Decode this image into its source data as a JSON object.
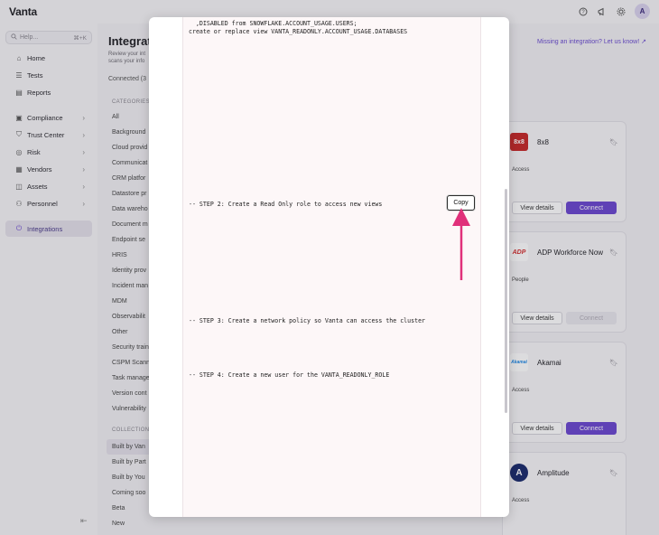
{
  "app": {
    "brand": "Vanta",
    "user_initial": "A"
  },
  "top_icons": [
    "help-icon",
    "megaphone-icon",
    "gear-icon"
  ],
  "sidebar": {
    "search_placeholder": "Help...",
    "search_shortcut": "⌘+K",
    "items": [
      {
        "label": "Home",
        "icon": "home-icon"
      },
      {
        "label": "Tests",
        "icon": "list-icon"
      },
      {
        "label": "Reports",
        "icon": "report-icon"
      },
      {
        "label": "Compliance",
        "icon": "checklist-icon",
        "chevron": true
      },
      {
        "label": "Trust Center",
        "icon": "shield-icon",
        "chevron": true
      },
      {
        "label": "Risk",
        "icon": "risk-icon",
        "chevron": true
      },
      {
        "label": "Vendors",
        "icon": "vendor-icon",
        "chevron": true
      },
      {
        "label": "Assets",
        "icon": "assets-icon",
        "chevron": true
      },
      {
        "label": "Personnel",
        "icon": "people-icon",
        "chevron": true
      },
      {
        "label": "Integrations",
        "icon": "plug-icon",
        "active": true
      }
    ]
  },
  "main": {
    "title": "Integrat",
    "subtitle_1": "Review your int",
    "subtitle_2": "scans your info",
    "connected": "Connected (3",
    "missing_link": "Missing an integration? Let us know!",
    "categories_head": "CATEGORIES",
    "categories": [
      "All",
      "Background",
      "Cloud provid",
      "Communicat",
      "CRM platfor",
      "Datastore pr",
      "Data wareho",
      "Document m",
      "Endpoint se",
      "HRIS",
      "Identity prov",
      "Incident man",
      "MDM",
      "Observabilit",
      "Other",
      "Security train",
      "CSPM Scann",
      "Task manage",
      "Version cont",
      "Vulnerability"
    ],
    "collections_head": "COLLECTION",
    "collections": [
      "Built by Van",
      "Built by Part",
      "Built by You",
      "Coming soo",
      "Beta",
      "New"
    ],
    "cards": [
      {
        "name": "8x8",
        "tag": "Access",
        "logo_text": "8x8",
        "logo_bg": "#c62828",
        "logo_fg": "#ffffff",
        "view": "View details",
        "connect": "Connect",
        "connect_enabled": true
      },
      {
        "name": "ADP Workforce Now",
        "tag": "People",
        "logo_text": "ADP",
        "logo_bg": "#ffffff",
        "logo_fg": "#d32f2f",
        "view": "View details",
        "connect": "Connect",
        "connect_enabled": false
      },
      {
        "name": "Akamai",
        "tag": "Access",
        "logo_text": "Akamai",
        "logo_bg": "#ffffff",
        "logo_fg": "#1e88e5",
        "view": "View details",
        "connect": "Connect",
        "connect_enabled": true
      },
      {
        "name": "Amplitude",
        "tag": "Access",
        "logo_text": "A",
        "logo_bg": "#1a2a6c",
        "logo_fg": "#ffffff",
        "view": "View details",
        "connect": "Connect",
        "connect_enabled": true
      }
    ]
  },
  "modal": {
    "code_lines": [
      {
        "text": "  ,DISABLED from SNOWFLAKE.ACCOUNT_USAGE.USERS;"
      },
      {
        "text": "create or replace view VANTA_READONLY.ACCOUNT_USAGE.DATABASES"
      },
      {
        "text": "-- STEP 2: Create a Read Only role to access new views"
      },
      {
        "text": "-- STEP 3: Create a network policy so Vanta can access the cluster"
      },
      {
        "text": "-- STEP 4: Create a new user for the VANTA_READONLY_ROLE"
      }
    ],
    "copy_label": "Copy"
  },
  "colors": {
    "accent": "#6b47d0",
    "arrow": "#e0307a"
  }
}
